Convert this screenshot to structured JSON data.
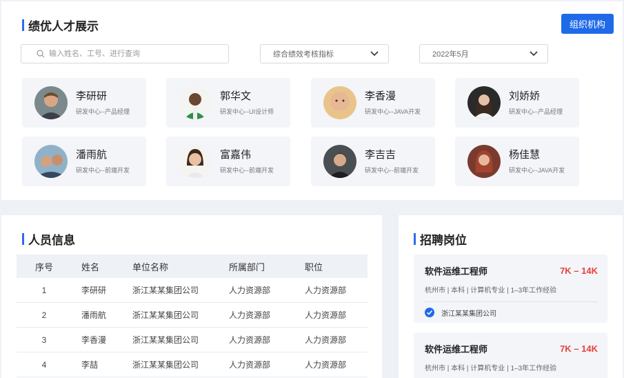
{
  "top": {
    "title": "绩优人才展示",
    "org_button": "组织机构",
    "search_placeholder": "输入姓名、工号、进行查询",
    "metric_select": "综合绩效考核指标",
    "date_select": "2022年5月",
    "people": [
      {
        "name": "李研研",
        "dept": "研发中心--产品经理"
      },
      {
        "name": "郭华文",
        "dept": "研发中心--UI设计师"
      },
      {
        "name": "李香漫",
        "dept": "研发中心--JAVA开发"
      },
      {
        "name": "刘娇娇",
        "dept": "研发中心--产品经理"
      },
      {
        "name": "潘雨航",
        "dept": "研发中心--前端开发"
      },
      {
        "name": "富嘉伟",
        "dept": "研发中心--前端开发"
      },
      {
        "name": "李吉吉",
        "dept": "研发中心--前端开发"
      },
      {
        "name": "杨佳慧",
        "dept": "研发中心--JAVA开发"
      }
    ]
  },
  "people_info": {
    "title": "人员信息",
    "headers": [
      "序号",
      "姓名",
      "单位名称",
      "所属部门",
      "职位"
    ],
    "rows": [
      [
        "1",
        "李研研",
        "浙江某某集团公司",
        "人力资源部",
        "人力资源部"
      ],
      [
        "2",
        "潘雨航",
        "浙江某某集团公司",
        "人力资源部",
        "人力资源部"
      ],
      [
        "3",
        "李香漫",
        "浙江某某集团公司",
        "人力资源部",
        "人力资源部"
      ],
      [
        "4",
        "李喆",
        "浙江某某集团公司",
        "人力资源部",
        "人力资源部"
      ]
    ]
  },
  "jobs": {
    "title": "招聘岗位",
    "items": [
      {
        "title": "软件运维工程师",
        "salary": "7K – 14K",
        "meta": "杭州市 | 本科 | 计算机专业 | 1–3年工作经验",
        "company": "浙江某某集团公司"
      },
      {
        "title": "软件运维工程师",
        "salary": "7K – 14K",
        "meta": "杭州市 | 本科 | 计算机专业 | 1–3年工作经验",
        "company": ""
      }
    ]
  },
  "colors": {
    "accent": "#1f6ae8",
    "salary": "#e8413c",
    "card_bg": "#f3f5f9"
  }
}
